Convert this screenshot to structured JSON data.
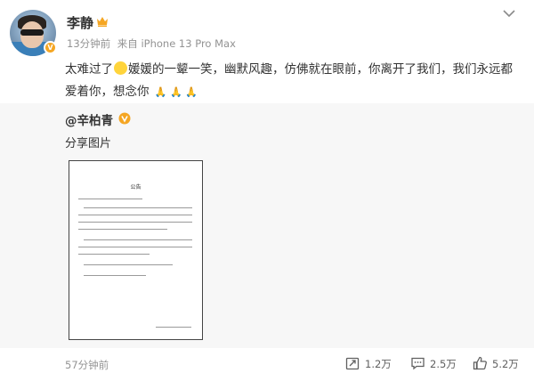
{
  "post": {
    "author": "李静",
    "meta_time": "13分钟前",
    "meta_source": "来自 iPhone 13 Pro Max",
    "text_part1": "太难过了",
    "text_part2": "媛媛的一颦一笑，幽默风趣，仿佛就在眼前，你离开了我们，我们永远都爱着你，想念你",
    "pray_emojis": "🙏 🙏 🙏"
  },
  "repost": {
    "author": "@辛柏青",
    "text": "分享图片",
    "image_title": "公告"
  },
  "footer": {
    "time": "57分钟前",
    "repost_count": "1.2万",
    "comment_count": "2.5万",
    "like_count": "5.2万"
  },
  "colors": {
    "username_text": "#333333",
    "meta_text": "#939393",
    "repost_bg": "#f7f7f7",
    "vip_gold": "#f5a623"
  },
  "icons": [
    "crown-icon",
    "chevron-down-icon",
    "gold-v-icon",
    "repost-icon",
    "comment-icon",
    "like-icon"
  ]
}
